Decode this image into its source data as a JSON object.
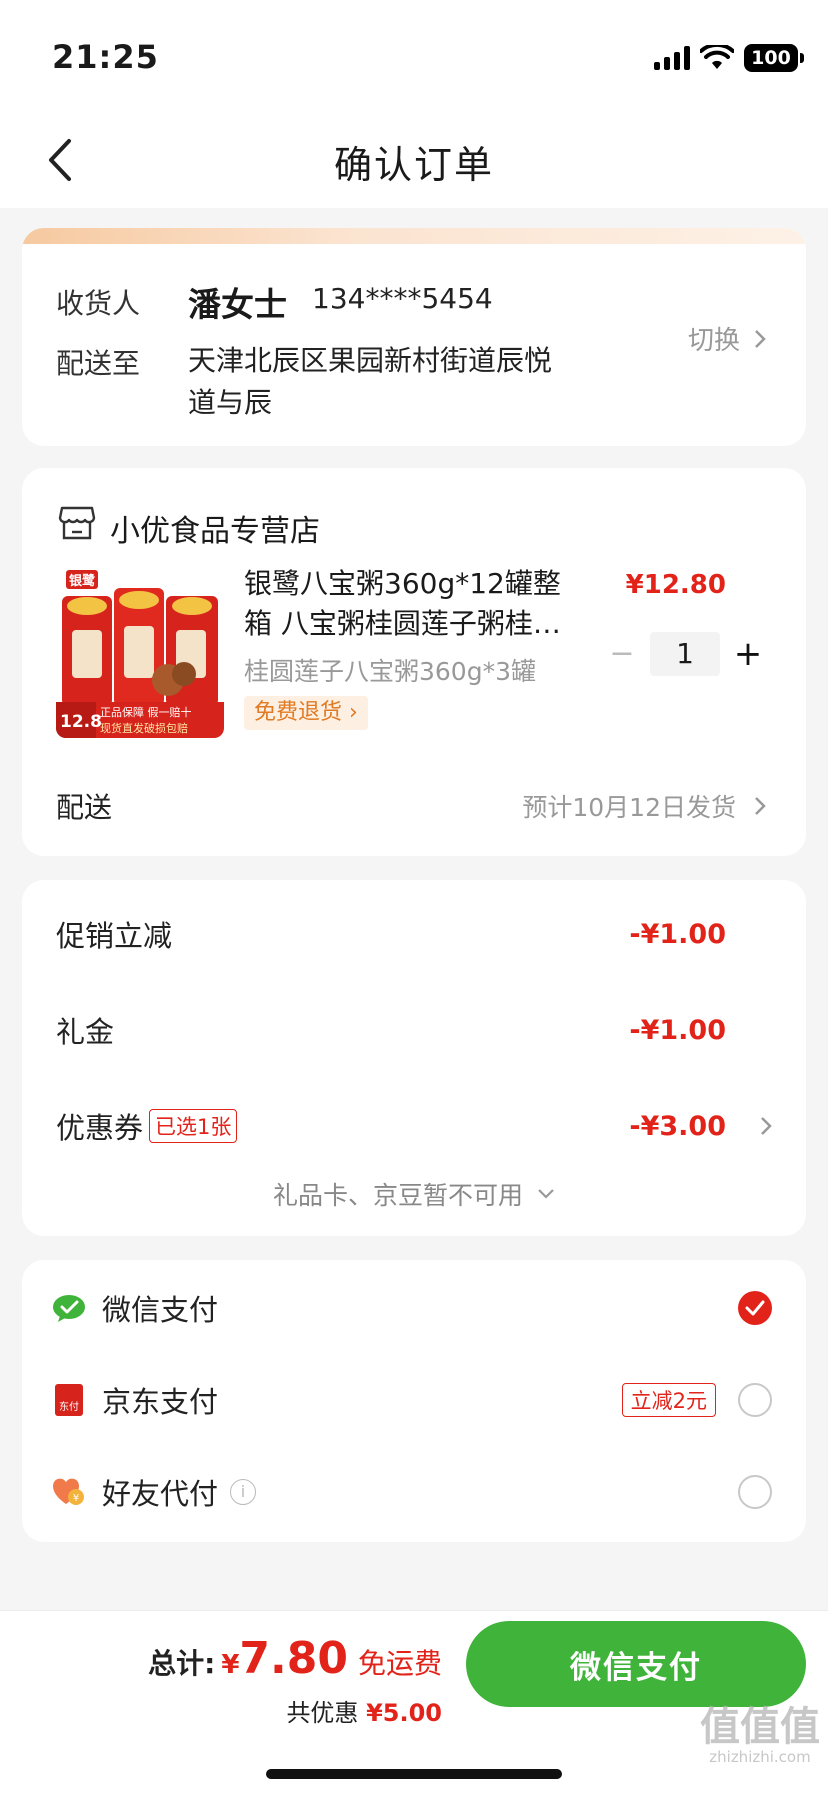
{
  "status_bar": {
    "time": "21:25",
    "battery": "100",
    "icons": [
      "signal-icon",
      "wifi-icon",
      "battery-icon"
    ]
  },
  "nav": {
    "title": "确认订单",
    "back_icon": "chevron-left-icon"
  },
  "address": {
    "recipient_label": "收货人",
    "recipient_name": "潘女士",
    "phone": "134****5454",
    "deliver_to_label": "配送至",
    "detail_line1": "天津北辰区果园新村街道辰悦",
    "detail_line2": "道与辰",
    "switch_label": "切换"
  },
  "store": {
    "name": "小优食品专营店",
    "icon": "store-icon",
    "product": {
      "title_line1": "银鹭八宝粥360g*12罐整",
      "title_line2": "箱 八宝粥桂圆莲子粥桂…",
      "spec": "桂圆莲子八宝粥360g*3罐",
      "badge": "免费退货",
      "price": "¥12.80",
      "quantity": "1",
      "image_text": {
        "brand": "银鹭",
        "price_tag": "12.8",
        "guarantee": "正品保障 假一赔十",
        "shipping": "现货直发破损包赔"
      }
    },
    "shipping_label": "配送",
    "shipping_value": "预计10月12日发货"
  },
  "discounts": {
    "rows": [
      {
        "label": "促销立减",
        "value": "-¥1.00"
      },
      {
        "label": "礼金",
        "value": "-¥1.00"
      },
      {
        "label": "优惠券",
        "tag": "已选1张",
        "value": "-¥3.00"
      }
    ],
    "unavailable": "礼品卡、京豆暂不可用"
  },
  "payment": {
    "methods": [
      {
        "label": "微信支付",
        "icon": "wechat-pay-icon",
        "selected": true
      },
      {
        "label": "京东支付",
        "icon": "jd-pay-icon",
        "promo": "立减2元",
        "selected": false
      },
      {
        "label": "好友代付",
        "icon": "friend-pay-icon",
        "info": "i",
        "selected": false
      }
    ],
    "jd_icon_text": "东付"
  },
  "footer": {
    "total_label": "总计:",
    "currency": "¥",
    "total_amount": "7.80",
    "free_shipping": "免运费",
    "saved_label": "共优惠",
    "saved_amount": "¥5.00",
    "pay_button": "微信支付"
  },
  "watermark": {
    "logo": "值值值",
    "site": "zhizhizhi.com"
  },
  "colors": {
    "accent_red": "#e2231a",
    "wechat_green": "#3fb33a",
    "orange_badge": "#e07a24"
  }
}
